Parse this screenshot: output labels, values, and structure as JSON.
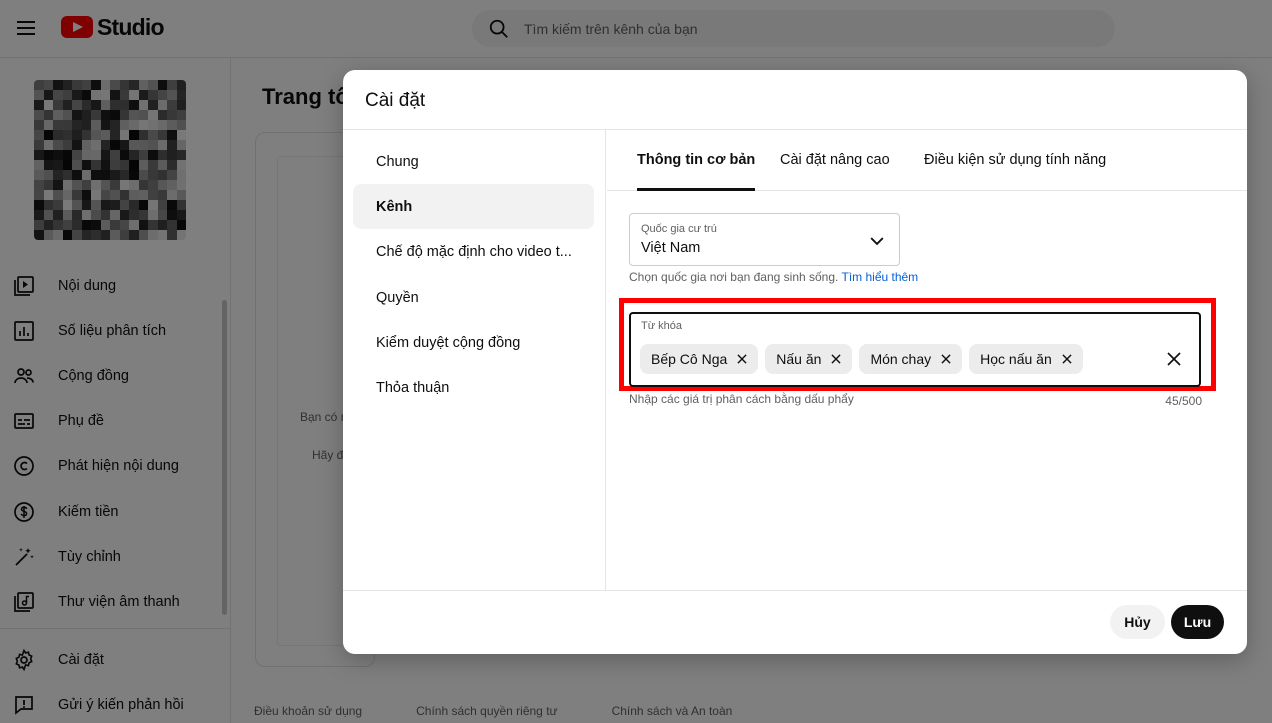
{
  "app": {
    "logo_text": "Studio",
    "search_placeholder": "Tìm kiếm trên kênh của bạn"
  },
  "sidebar": {
    "items": [
      {
        "label": "Nội dung",
        "icon": "content-icon"
      },
      {
        "label": "Số liệu phân tích",
        "icon": "analytics-icon"
      },
      {
        "label": "Cộng đồng",
        "icon": "community-icon"
      },
      {
        "label": "Phụ đề",
        "icon": "subtitles-icon"
      },
      {
        "label": "Phát hiện nội dung",
        "icon": "copyright-icon"
      },
      {
        "label": "Kiếm tiền",
        "icon": "dollar-icon"
      },
      {
        "label": "Tùy chỉnh",
        "icon": "magic-wand-icon"
      },
      {
        "label": "Thư viện âm thanh",
        "icon": "audio-library-icon"
      }
    ],
    "bottom_items": [
      {
        "label": "Cài đặt",
        "icon": "gear-icon"
      },
      {
        "label": "Gửi ý kiến phản hồi",
        "icon": "feedback-icon"
      }
    ]
  },
  "main": {
    "title": "Trang tổ",
    "text1": "Bạn có n",
    "text2": "Hãy đ",
    "footer_links": [
      "Điều khoản sử dụng",
      "Chính sách quyền riêng tư",
      "Chính sách và An toàn"
    ]
  },
  "dialog": {
    "title": "Cài đặt",
    "nav": [
      {
        "label": "Chung"
      },
      {
        "label": "Kênh"
      },
      {
        "label": "Chế độ mặc định cho video t..."
      },
      {
        "label": "Quyền"
      },
      {
        "label": "Kiểm duyệt cộng đồng"
      },
      {
        "label": "Thỏa thuận"
      }
    ],
    "tabs": [
      {
        "label": "Thông tin cơ bản"
      },
      {
        "label": "Cài đặt nâng cao"
      },
      {
        "label": "Điều kiện sử dụng tính năng"
      }
    ],
    "country": {
      "label": "Quốc gia cư trú",
      "value": "Việt Nam",
      "helper": "Chọn quốc gia nơi bạn đang sinh sống.",
      "helper_link": "Tìm hiểu thêm"
    },
    "keywords": {
      "label": "Từ khóa",
      "chips": [
        "Bếp Cô Nga",
        "Nấu ăn",
        "Món chay",
        "Học nấu ăn"
      ],
      "helper": "Nhập các giá trị phân cách bằng dấu phẩy",
      "count": "45/500"
    },
    "buttons": {
      "cancel": "Hủy",
      "save": "Lưu"
    }
  },
  "colors": {
    "brand_red": "#ff0000",
    "link": "#065fd4",
    "highlight": "#ff0000",
    "primary_button": "#0f0f0f"
  }
}
